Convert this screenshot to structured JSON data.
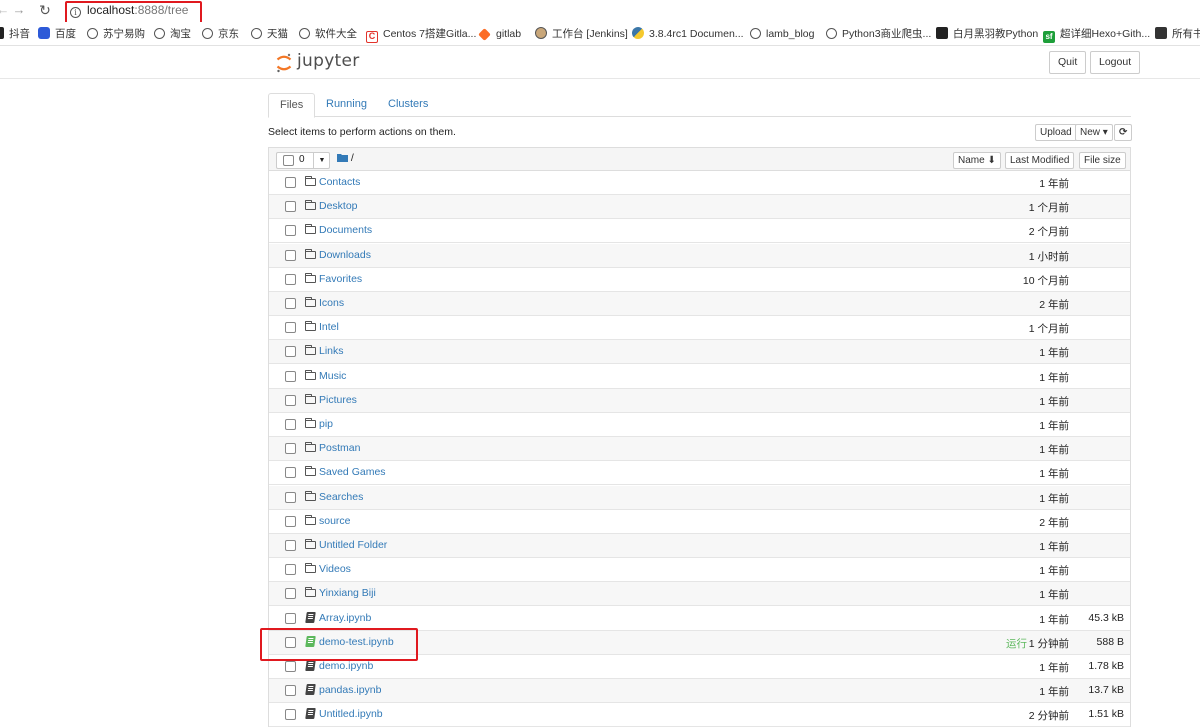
{
  "browser": {
    "url_host": "localhost",
    "url_path": ":8888/tree",
    "bookmarks": [
      {
        "label": "抖音",
        "icon": "douyin-icon",
        "cls": "dark"
      },
      {
        "label": "百度",
        "icon": "baidu-paw-icon",
        "cls": "paw"
      },
      {
        "label": "苏宁易购",
        "icon": "globe-icon",
        "cls": "globe"
      },
      {
        "label": "淘宝",
        "icon": "globe-icon",
        "cls": "globe"
      },
      {
        "label": "京东",
        "icon": "globe-icon",
        "cls": "globe"
      },
      {
        "label": "天猫",
        "icon": "globe-icon",
        "cls": "globe"
      },
      {
        "label": "软件大全",
        "icon": "globe-icon",
        "cls": "globe"
      },
      {
        "label": "Centos 7搭建Gitla...",
        "icon": "csdn-icon",
        "cls": "csdn",
        "glyph": "C"
      },
      {
        "label": "gitlab",
        "icon": "gitlab-icon",
        "cls": "gitlab"
      },
      {
        "label": "工作台 [Jenkins]",
        "icon": "jenkins-icon",
        "cls": "jenkins"
      },
      {
        "label": "3.8.4rc1 Documen...",
        "icon": "python-icon",
        "cls": "python"
      },
      {
        "label": "lamb_blog",
        "icon": "globe-icon",
        "cls": "globe"
      },
      {
        "label": "Python3商业爬虫...",
        "icon": "globe-icon",
        "cls": "globe"
      },
      {
        "label": "白月黑羽教Python",
        "icon": "blog-icon",
        "cls": "dark"
      },
      {
        "label": "超详细Hexo+Gith...",
        "icon": "sf-icon",
        "cls": "sf",
        "glyph": "sf"
      },
      {
        "label": "所有书",
        "icon": "cloud-icon",
        "cls": "cloud"
      }
    ]
  },
  "header": {
    "logo_text": "jupyter",
    "quit_label": "Quit",
    "logout_label": "Logout"
  },
  "tabs": [
    {
      "label": "Files"
    },
    {
      "label": "Running"
    },
    {
      "label": "Clusters"
    }
  ],
  "toolbar": {
    "hint": "Select items to perform actions on them.",
    "upload_label": "Upload",
    "new_label": "New ▾",
    "refresh_glyph": "⟳"
  },
  "list_header": {
    "selected_count": "0",
    "root_path": "/",
    "name_label": "Name ⬇",
    "modified_label": "Last Modified",
    "size_label": "File size"
  },
  "files": [
    {
      "name": "Contacts",
      "type": "folder",
      "modified": "1 年前",
      "size": "",
      "status": ""
    },
    {
      "name": "Desktop",
      "type": "folder",
      "modified": "1 个月前",
      "size": "",
      "status": ""
    },
    {
      "name": "Documents",
      "type": "folder",
      "modified": "2 个月前",
      "size": "",
      "status": ""
    },
    {
      "name": "Downloads",
      "type": "folder",
      "modified": "1 小时前",
      "size": "",
      "status": ""
    },
    {
      "name": "Favorites",
      "type": "folder",
      "modified": "10 个月前",
      "size": "",
      "status": ""
    },
    {
      "name": "Icons",
      "type": "folder",
      "modified": "2 年前",
      "size": "",
      "status": ""
    },
    {
      "name": "Intel",
      "type": "folder",
      "modified": "1 个月前",
      "size": "",
      "status": ""
    },
    {
      "name": "Links",
      "type": "folder",
      "modified": "1 年前",
      "size": "",
      "status": ""
    },
    {
      "name": "Music",
      "type": "folder",
      "modified": "1 年前",
      "size": "",
      "status": ""
    },
    {
      "name": "Pictures",
      "type": "folder",
      "modified": "1 年前",
      "size": "",
      "status": ""
    },
    {
      "name": "pip",
      "type": "folder",
      "modified": "1 年前",
      "size": "",
      "status": ""
    },
    {
      "name": "Postman",
      "type": "folder",
      "modified": "1 年前",
      "size": "",
      "status": ""
    },
    {
      "name": "Saved Games",
      "type": "folder",
      "modified": "1 年前",
      "size": "",
      "status": ""
    },
    {
      "name": "Searches",
      "type": "folder",
      "modified": "1 年前",
      "size": "",
      "status": ""
    },
    {
      "name": "source",
      "type": "folder",
      "modified": "2 年前",
      "size": "",
      "status": ""
    },
    {
      "name": "Untitled Folder",
      "type": "folder",
      "modified": "1 年前",
      "size": "",
      "status": ""
    },
    {
      "name": "Videos",
      "type": "folder",
      "modified": "1 年前",
      "size": "",
      "status": ""
    },
    {
      "name": "Yinxiang Biji",
      "type": "folder",
      "modified": "1 年前",
      "size": "",
      "status": ""
    },
    {
      "name": "Array.ipynb",
      "type": "notebook",
      "modified": "1 年前",
      "size": "45.3 kB",
      "status": ""
    },
    {
      "name": "demo-test.ipynb",
      "type": "notebook-running",
      "modified": "1 分钟前",
      "size": "588 B",
      "status": "运行"
    },
    {
      "name": "demo.ipynb",
      "type": "notebook",
      "modified": "1 年前",
      "size": "1.78 kB",
      "status": ""
    },
    {
      "name": "pandas.ipynb",
      "type": "notebook",
      "modified": "1 年前",
      "size": "13.7 kB",
      "status": ""
    },
    {
      "name": "Untitled.ipynb",
      "type": "notebook",
      "modified": "2 分钟前",
      "size": "1.51 kB",
      "status": ""
    }
  ],
  "colors": {
    "link": "#337ab7",
    "running": "#5cb85c",
    "highlight_box": "#e0191f",
    "logo_orange": "#f37726"
  }
}
